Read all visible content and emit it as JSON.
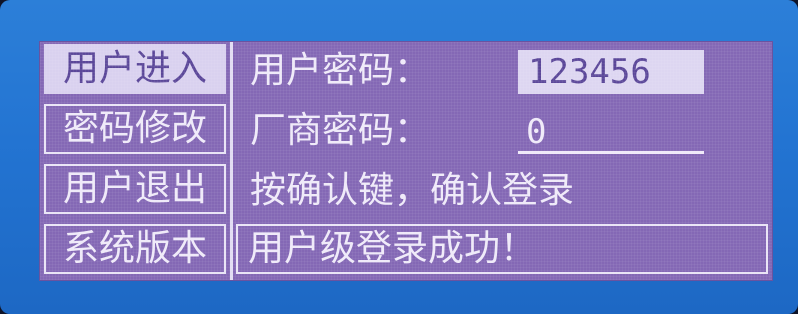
{
  "menu": {
    "items": [
      {
        "label": "用户进入",
        "selected": true
      },
      {
        "label": "密码修改",
        "selected": false
      },
      {
        "label": "用户退出",
        "selected": false
      },
      {
        "label": "系统版本",
        "selected": false
      }
    ]
  },
  "login": {
    "user_password_label": "用户密码：",
    "user_password_value": "123456",
    "vendor_password_label": "厂商密码：",
    "vendor_password_value": "0",
    "hint": "按确认键，确认登录"
  },
  "status": {
    "message": "用户级登录成功！"
  },
  "colors": {
    "bezel": "#2374d2",
    "panel": "#8468b5",
    "text": "#efeaf9",
    "highlight_bg": "#d9d1ef",
    "highlight_text": "#5b4799"
  }
}
